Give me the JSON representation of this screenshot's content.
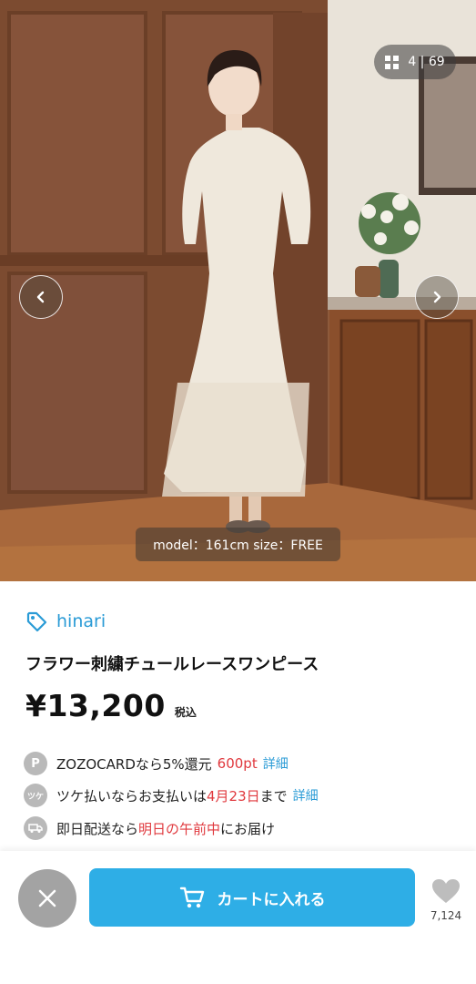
{
  "gallery": {
    "counter": "4 | 69",
    "caption": "model：161cm size：FREE",
    "prev_icon": "chevron-left-icon",
    "next_icon": "chevron-right-icon"
  },
  "product": {
    "brand": "hinari",
    "title": "フラワー刺繍チュールレースワンピース",
    "price": "¥13,200",
    "tax_label": "税込"
  },
  "benefits": {
    "zozocard": {
      "icon": "P",
      "prefix": "ZOZOCARDなら5%還元",
      "points": "600pt",
      "link": "詳細"
    },
    "tsuke": {
      "icon": "ツケ",
      "prefix": "ツケ払いならお支払いは",
      "date": "4月23日",
      "suffix": "まで",
      "link": "詳細"
    },
    "shipping": {
      "prefix": "即日配送なら",
      "highlight": "明日の午前中",
      "suffix": "にお届け"
    }
  },
  "actions": {
    "cart_label": "カートに入れる",
    "favorite_count": "7,124"
  },
  "colors": {
    "accent": "#2eaee6",
    "brand_link": "#2a9bd6",
    "highlight_red": "#e0393e"
  }
}
